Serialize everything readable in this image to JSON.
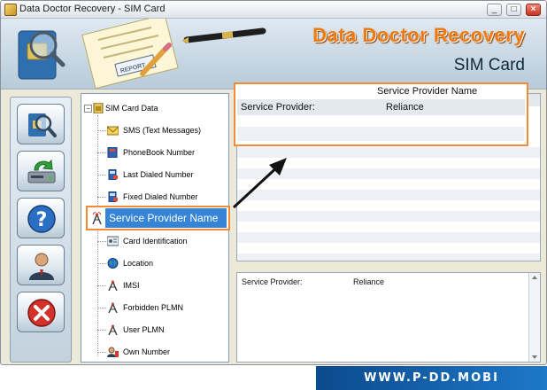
{
  "window": {
    "title": "Data Doctor Recovery - SIM Card",
    "controls": {
      "minimize": "_",
      "maximize": "□",
      "close": "×"
    }
  },
  "banner": {
    "brand": "Data Doctor Recovery",
    "product": "SIM Card",
    "art_text": "REPORT"
  },
  "sidebar": {
    "buttons": [
      {
        "name": "search-sim-button",
        "icon": "sim-magnifier-icon"
      },
      {
        "name": "save-button",
        "icon": "save-drive-icon"
      },
      {
        "name": "help-button",
        "icon": "help-icon"
      },
      {
        "name": "about-button",
        "icon": "user-icon"
      },
      {
        "name": "exit-button",
        "icon": "close-icon"
      }
    ]
  },
  "tree": {
    "root": {
      "label": "SIM Card Data",
      "expander": "−",
      "icon": "sim-card-icon"
    },
    "items": [
      {
        "label": "SMS (Text Messages)",
        "icon": "envelope-icon"
      },
      {
        "label": "PhoneBook Number",
        "icon": "phonebook-icon"
      },
      {
        "label": "Last Dialed Number",
        "icon": "phone-icon"
      },
      {
        "label": "Fixed Dialed Number",
        "icon": "phone-icon"
      },
      {
        "label": "Service Provider Name",
        "icon": "tower-icon",
        "selected": true
      },
      {
        "label": "Card Identification",
        "icon": "id-card-icon"
      },
      {
        "label": "Location",
        "icon": "globe-icon"
      },
      {
        "label": "IMSI",
        "icon": "tower-icon"
      },
      {
        "label": "Forbidden PLMN",
        "icon": "tower-icon"
      },
      {
        "label": "User PLMN",
        "icon": "tower-icon"
      },
      {
        "label": "Own Number",
        "icon": "user-phone-icon"
      }
    ]
  },
  "grid": {
    "column_header": "Service Provider Name",
    "row": {
      "key": "Service Provider:",
      "value": "Reliance"
    }
  },
  "detail": {
    "key": "Service Provider:",
    "value": "Reliance"
  },
  "footer": {
    "url": "WWW.P-DD.MOBI"
  },
  "colors": {
    "highlight_border": "#f28a36",
    "selection": "#3584d6",
    "brand_orange": "#f07a10",
    "url_blue": "#0b4a8c"
  }
}
